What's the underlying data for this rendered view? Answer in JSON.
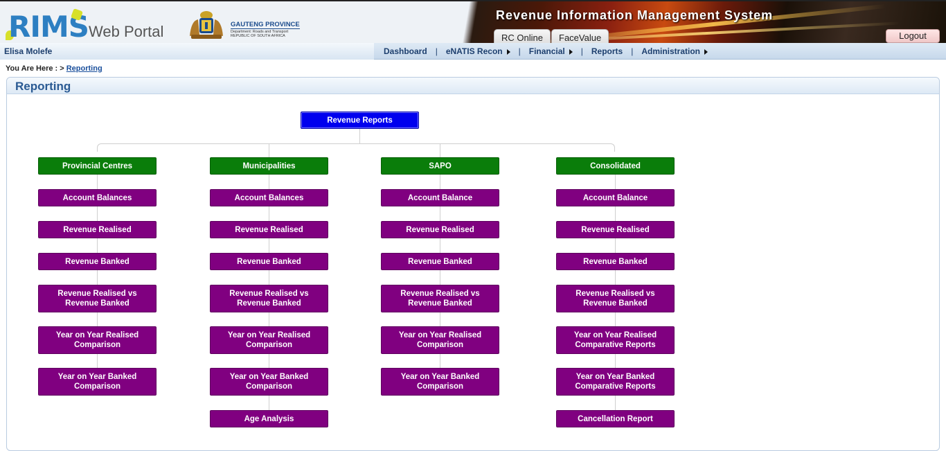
{
  "header": {
    "logo_text": "RIMS",
    "logo_subtitle": "Web Portal",
    "province_name": "GAUTENG PROVINCE",
    "province_dept": "Department: Roads and Transport",
    "province_country": "REPUBLIC OF SOUTH AFRICA",
    "banner_title": "Revenue Information Management System",
    "tabs": [
      {
        "label": "RC Online"
      },
      {
        "label": "FaceValue"
      }
    ],
    "logout_label": "Logout"
  },
  "navbar": {
    "user": "Elisa Molefe",
    "items": [
      {
        "label": "Dashboard",
        "has_submenu": false
      },
      {
        "label": "eNATIS Recon",
        "has_submenu": true
      },
      {
        "label": "Financial",
        "has_submenu": true
      },
      {
        "label": "Reports",
        "has_submenu": false
      },
      {
        "label": "Administration",
        "has_submenu": true
      }
    ],
    "separator": "|"
  },
  "breadcrumb": {
    "prefix": "You Are Here : >",
    "current": "Reporting"
  },
  "panel": {
    "title": "Reporting"
  },
  "chart": {
    "root": "Revenue Reports",
    "columns": [
      {
        "category": "Provincial Centres",
        "reports": [
          "Account Balances",
          "Revenue Realised",
          "Revenue Banked",
          "Revenue Realised vs Revenue Banked",
          "Year on Year Realised Comparison",
          "Year on Year Banked Comparison"
        ]
      },
      {
        "category": "Municipalities",
        "reports": [
          "Account Balances",
          "Revenue Realised",
          "Revenue Banked",
          "Revenue Realised vs Revenue Banked",
          "Year on Year Realised Comparison",
          "Year on Year Banked Comparison",
          "Age Analysis"
        ]
      },
      {
        "category": "SAPO",
        "reports": [
          "Account Balance",
          "Revenue Realised",
          "Revenue Banked",
          "Revenue Realised vs Revenue Banked",
          "Year on Year Realised Comparison",
          "Year on Year Banked Comparison"
        ]
      },
      {
        "category": "Consolidated",
        "reports": [
          "Account Balance",
          "Revenue Realised",
          "Revenue Banked",
          "Revenue Realised vs Revenue Banked",
          "Year on Year Realised Comparative Reports",
          "Year on Year Banked Comparative Reports",
          "Cancellation Report"
        ]
      }
    ]
  },
  "colors": {
    "root_node": "#0000ee",
    "category_node": "#0a7d0a",
    "report_node": "#800080",
    "nav_text": "#1d3f6e"
  }
}
